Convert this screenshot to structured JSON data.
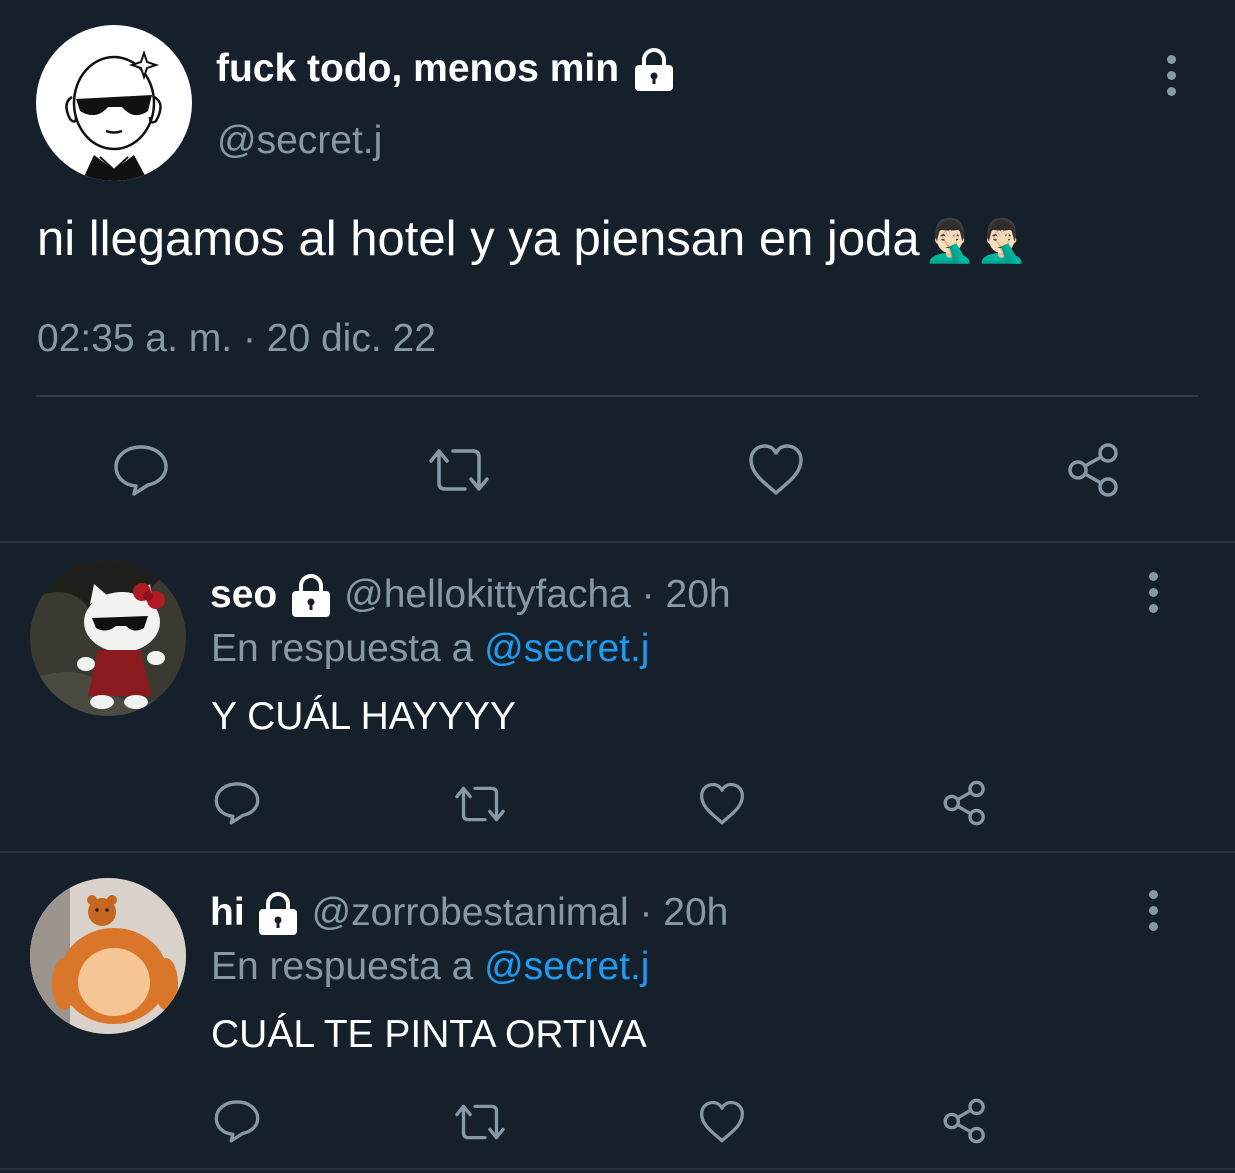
{
  "main_tweet": {
    "display_name": "fuck todo, menos min",
    "handle": "@secret.j",
    "text": "ni llegamos al hotel y ya piensan en joda",
    "emoji": "🤦🏻‍♂️🤦🏻‍♂️",
    "timestamp": "02:35 a. m. · 20 dic. 22",
    "icons": [
      "lock-icon",
      "more-icon",
      "reply-icon",
      "retweet-icon",
      "like-icon",
      "share-icon"
    ]
  },
  "replies": [
    {
      "display_name": "seo",
      "handle": "@hellokittyfacha",
      "time": " · 20h",
      "reply_prefix": "En respuesta a ",
      "reply_to": "@secret.j",
      "text": "Y CUÁL HAYYYY"
    },
    {
      "display_name": "hi",
      "handle": "@zorrobestanimal",
      "time": " · 20h",
      "reply_prefix": "En respuesta a ",
      "reply_to": "@secret.j",
      "text": "CUÁL TE PINTA ORTIVA"
    }
  ],
  "colors": {
    "background": "#15202b",
    "text": "#ffffff",
    "muted": "#8899a6",
    "link": "#1d9bf0",
    "divider": "#2a3540"
  }
}
